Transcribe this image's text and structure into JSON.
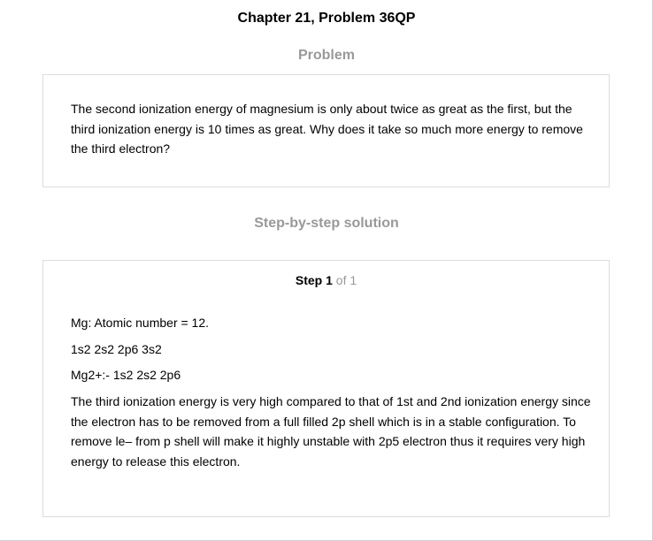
{
  "header": {
    "title": "Chapter 21, Problem 36QP"
  },
  "problem": {
    "heading": "Problem",
    "text": "The second ionization energy of magnesium is only about twice as great as the first, but the third ionization energy is 10 times as great. Why does it take so much more energy to remove the third electron?"
  },
  "solution": {
    "heading": "Step-by-step solution",
    "step": {
      "label": "Step",
      "number": "1",
      "of_text": "of 1"
    },
    "lines": [
      "Mg: Atomic number = 12.",
      "1s2 2s2 2p6 3s2",
      "Mg2+:- 1s2 2s2 2p6",
      "The third ionization energy is very high compared to that of 1st and 2nd ionization energy since the electron has to be removed from a full filled 2p shell which is in a stable configuration. To remove le– from p shell will make it highly unstable with 2p5 electron thus it requires very high energy to release this electron."
    ]
  }
}
